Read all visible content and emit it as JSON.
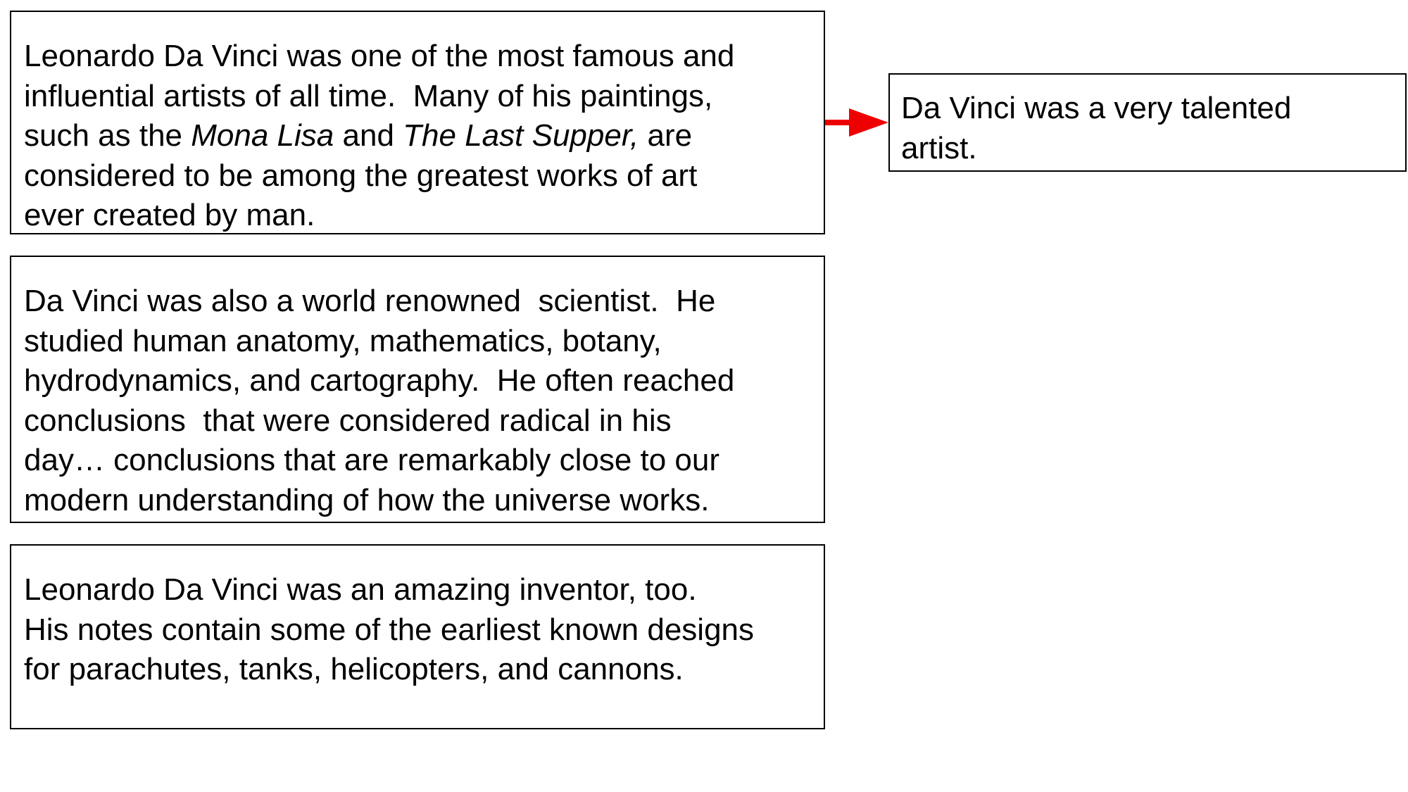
{
  "diagram": {
    "boxes": {
      "artist": {
        "lines": [
          "Leonardo Da Vinci was one of the most famous and",
          "influential artists of all time.  Many of his paintings,",
          "such as the ",
          "Mona Lisa",
          " and ",
          "The Last Supper,",
          " are",
          "considered to be among the greatest works of art",
          "ever created by man."
        ]
      },
      "scientist": {
        "lines": [
          "Da Vinci was also a world renowned  scientist.  He",
          "studied human anatomy, mathematics, botany,",
          "hydrodynamics, and cartography.  He often reached",
          "conclusions  that were considered radical in his",
          "day… conclusions that are remarkably close to our",
          "modern understanding of how the universe works."
        ]
      },
      "inventor": {
        "lines": [
          "Leonardo Da Vinci was an amazing inventor, too.",
          "His notes contain some of the earliest known designs",
          "for parachutes, tanks, helicopters, and cannons."
        ]
      },
      "summary": {
        "lines": [
          "Da Vinci was a very talented",
          "artist."
        ]
      }
    },
    "arrow": {
      "from": "artist",
      "to": "summary",
      "color": "#ee0000"
    }
  }
}
